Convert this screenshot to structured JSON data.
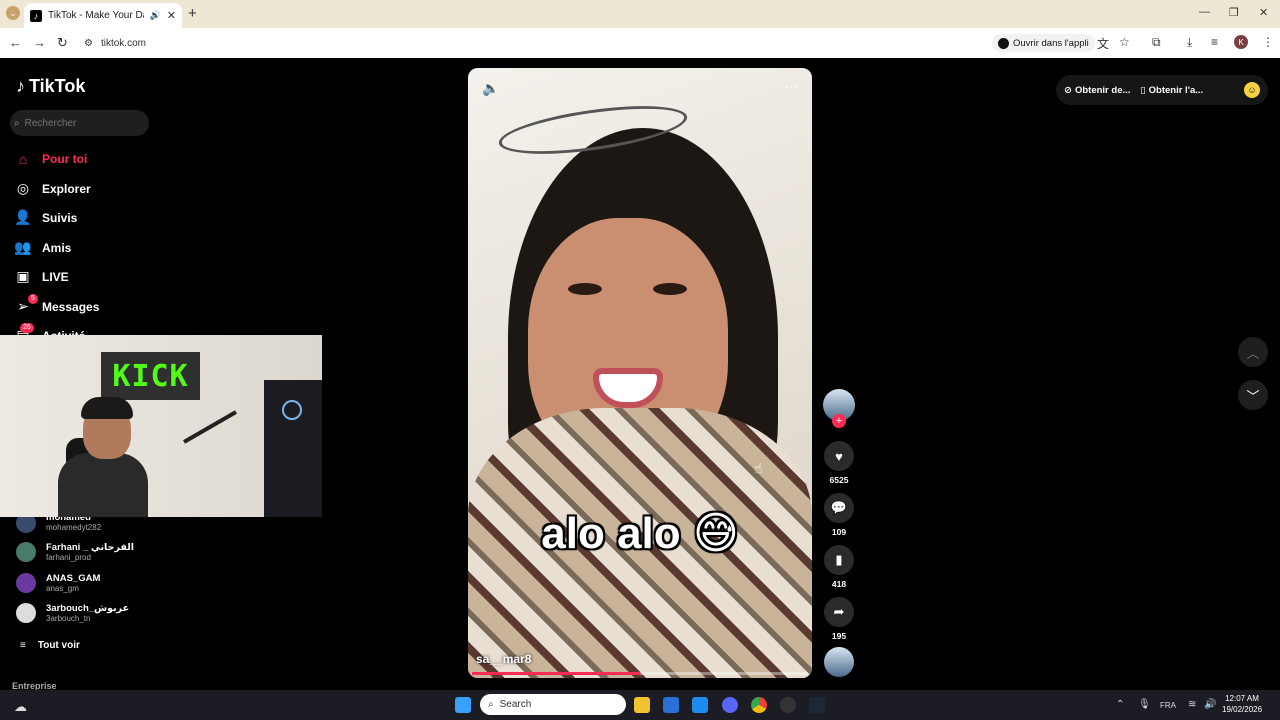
{
  "browser": {
    "tab_title": "TikTok - Make Your Day",
    "url": "tiktok.com",
    "open_app_label": "Ouvrir dans l'appli",
    "profile_initial": "K"
  },
  "sidebar": {
    "logo": "TikTok",
    "search_placeholder": "Rechercher",
    "nav": [
      {
        "label": "Pour toi",
        "icon": "home-icon"
      },
      {
        "label": "Explorer",
        "icon": "compass-icon"
      },
      {
        "label": "Suivis",
        "icon": "user-icon"
      },
      {
        "label": "Amis",
        "icon": "friends-icon"
      },
      {
        "label": "LIVE",
        "icon": "live-icon"
      },
      {
        "label": "Messages",
        "icon": "paper-plane-icon",
        "badge": "5"
      },
      {
        "label": "Activité",
        "icon": "inbox-icon",
        "badge": "26"
      }
    ],
    "following": [
      {
        "name": "mohamed",
        "handle": "mohamedyt282"
      },
      {
        "name": "Farhani _ الفرحاني",
        "handle": "farhani_prod"
      },
      {
        "name": "ANAS_GAM",
        "handle": "anas_gm"
      },
      {
        "name": "3arbouch_عربوش",
        "handle": "3arbouch_tn"
      }
    ],
    "see_all": "Tout voir",
    "company": "Entreprise"
  },
  "webcam": {
    "sign_text": "KICK"
  },
  "video": {
    "caption": "alo alo 😅",
    "username": "sa__mar8",
    "progress": 0.5
  },
  "actions": {
    "likes": "6525",
    "comments": "109",
    "saves": "418",
    "shares": "195"
  },
  "topright": {
    "get_coins": "Obtenir de...",
    "get_app": "Obtenir l'a..."
  },
  "taskbar": {
    "search_placeholder": "Search",
    "lang": "FRA",
    "time": "12:07 AM",
    "date": "19/02/2026"
  }
}
